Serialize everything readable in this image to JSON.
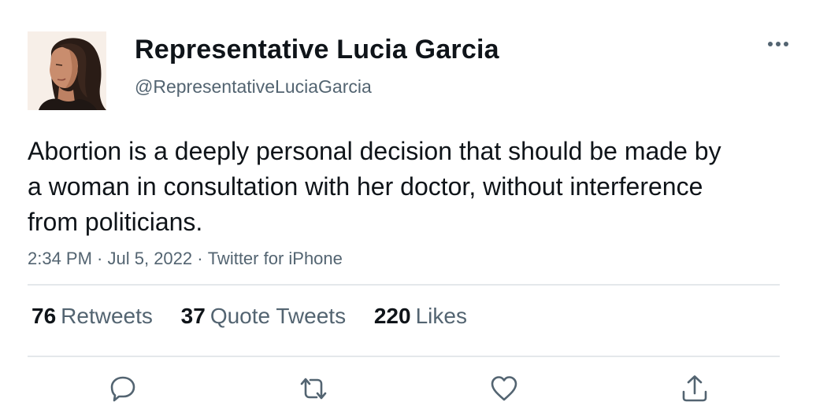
{
  "author": {
    "display_name": "Representative Lucia Garcia",
    "handle": "@RepresentativeLuciaGarcia",
    "avatar_icon": "profile-photo"
  },
  "tweet": {
    "text": "Abortion is a deeply personal decision that should be made by a woman in consultation with her doctor, without interference from politicians.",
    "time": "2:34 PM",
    "date": "Jul 5, 2022",
    "source": "Twitter for iPhone",
    "separator": " · "
  },
  "stats": {
    "retweets": {
      "count": "76",
      "label": "Retweets"
    },
    "quotes": {
      "count": "37",
      "label": "Quote Tweets"
    },
    "likes": {
      "count": "220",
      "label": "Likes"
    }
  },
  "actions": [
    "reply-icon",
    "retweet-icon",
    "like-icon",
    "share-icon"
  ],
  "colors": {
    "text": "#0f1419",
    "secondary": "#536471",
    "divider": "#e4e8eb",
    "icon": "#536471"
  }
}
